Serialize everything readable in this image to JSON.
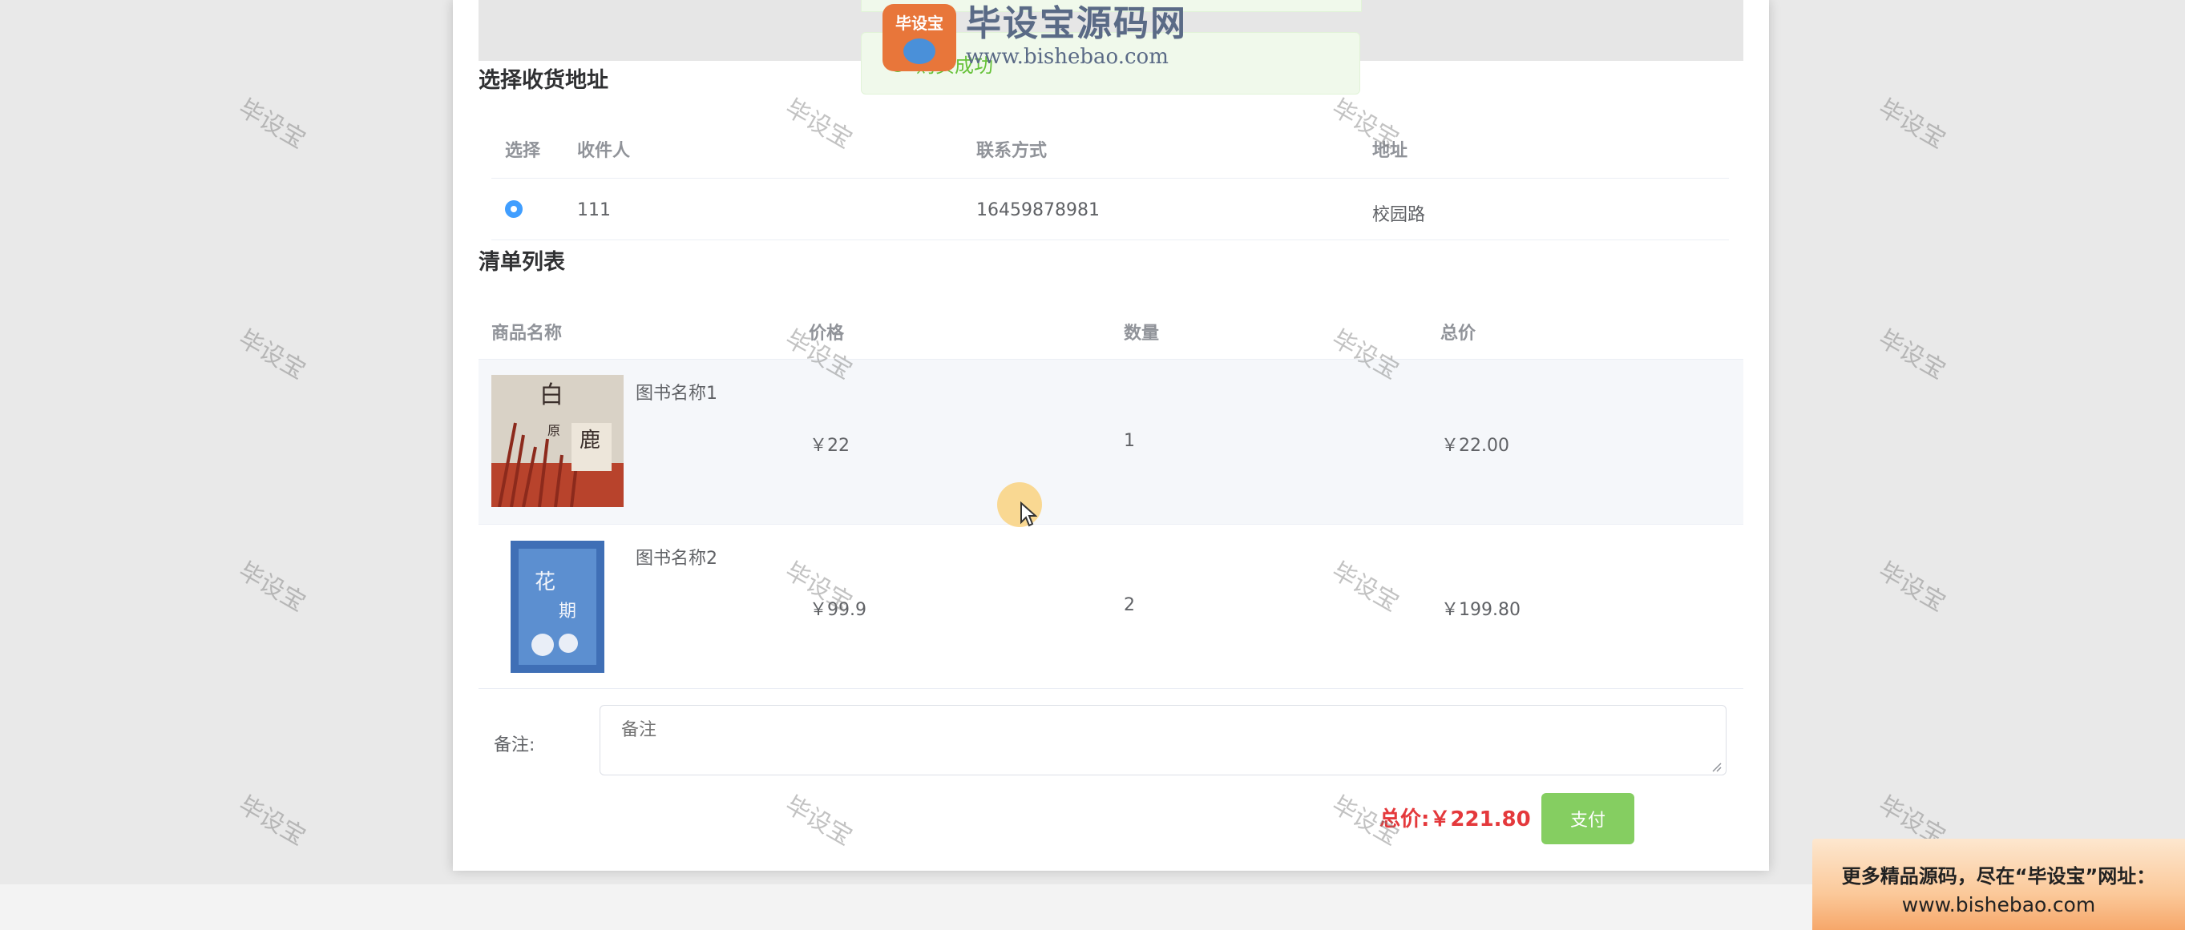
{
  "toast": {
    "text": "购买成功"
  },
  "logo": {
    "badge": "毕设宝",
    "title": "毕设宝源码网",
    "url": "www.bishebao.com"
  },
  "address_section": {
    "title": "选择收货地址",
    "headers": [
      "选择",
      "收件人",
      "联系方式",
      "地址"
    ],
    "rows": [
      {
        "recipient": "111",
        "phone": "16459878981",
        "address": "校园路",
        "selected": true
      }
    ]
  },
  "list_section": {
    "title": "清单列表",
    "headers": [
      "商品名称",
      "价格",
      "数量",
      "总价"
    ],
    "items": [
      {
        "name": "图书名称1",
        "price": "￥22",
        "qty": "1",
        "total": "￥22.00"
      },
      {
        "name": "图书名称2",
        "price": "￥99.9",
        "qty": "2",
        "total": "￥199.80"
      }
    ]
  },
  "remark": {
    "label": "备注:",
    "placeholder": "备注"
  },
  "footer": {
    "total_label": "总价:￥221.80",
    "pay_label": "支付"
  },
  "watermark": "毕设宝",
  "promo": {
    "line1": "更多精品源码，尽在“毕设宝”网址：",
    "line2": "www.bishebao.com"
  },
  "colors": {
    "primary": "#409eff",
    "success": "#67c23a",
    "pay_button": "#85ce61",
    "price_red": "#e4393c"
  }
}
